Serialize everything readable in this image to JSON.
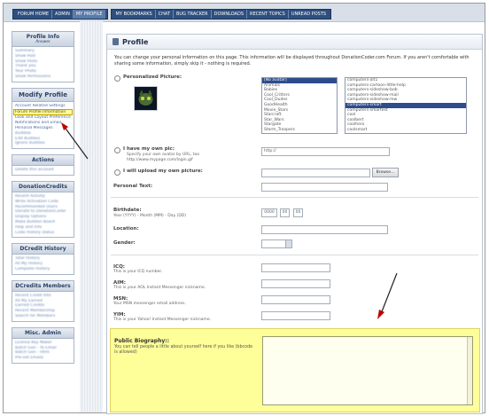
{
  "nav": {
    "group1": [
      "FORUM HOME",
      "ADMIN",
      "MY PROFILE"
    ],
    "active": "MY PROFILE",
    "group2": [
      "MY BOOKMARKS",
      "CHAT",
      "BUG TRACKER",
      "DOWNLOADS",
      "RECENT TOPICS",
      "UNREAD POSTS"
    ]
  },
  "sidebar": {
    "profile_info": {
      "title": "Profile Info",
      "subtitle": "Answer",
      "links": [
        "Summary",
        "Show Post",
        "Show Posts",
        "Thank you",
        "Your Photo",
        "Show Permissions"
      ]
    },
    "modify_profile": {
      "title": "Modify Profile",
      "links": [
        "Account Related Settings",
        "Forum Profile Information",
        "Look and Layout Preferences",
        "Notifications and Email",
        "Personal Messages",
        "Buddies",
        "Edit Buddies",
        "Ignore Buddies"
      ]
    },
    "actions": {
      "title": "Actions",
      "links": [
        "Delete this account"
      ]
    },
    "donation": {
      "title": "DonationCredits",
      "links": [
        "Recent Activity",
        "Write Activation Code",
        "Recommended Users",
        "Donate to DonationCoder",
        "Display Options",
        "Make Bulletin Board",
        "Help and Info",
        "Code History status"
      ]
    },
    "dcredit": {
      "title": "DCredit History",
      "links": [
        "Total History",
        "All My History",
        "Complete History"
      ]
    },
    "members": {
      "title": "DCredits Members",
      "links": [
        "Recent Credit Info",
        "All My Earned",
        "Earned Credits",
        "Recent Membership",
        "Search for Members"
      ]
    },
    "misc": {
      "title": "Misc. Admin",
      "links": [
        "License Key Maker",
        "Batch Gen - Yo Email",
        "Batch Gen - Html",
        "Pre-set Emails"
      ]
    }
  },
  "page": {
    "title": "Profile",
    "intro": "You can change your personal information on this page. This information will be displayed throughout DonationCoder.com Forum. If you aren't comfortable with sharing some information, simply skip it - nothing is required.",
    "personal_picture": "Personalized Picture:",
    "gallery_left": [
      "[No avatar]",
      "Animals",
      "Babies",
      "Cool_Critters",
      "Cool_Dudes",
      "GoodHealth",
      "Movie_Stars",
      "Starcraft",
      "Star_Wars",
      "Stargate",
      "Storm_Troopers"
    ],
    "gallery_right": [
      "computers-alt1",
      "computers-cartoon-little-help",
      "computers-sideshow-bob",
      "computers-sideshow-mail",
      "computers-sideshow-mw",
      "computers-smart",
      "computers-smartest",
      "cool",
      "coolbert",
      "coolhero",
      "coolsmart"
    ],
    "gallery_right_selected": "computers-smartest",
    "own_pic_label": "I have my own pic:",
    "own_pic_hint1": "Specify your own avatar by URL, too",
    "own_pic_hint2": "http://www.mypage.com/login.gif",
    "own_pic_value": "http://",
    "upload_label": "I will upload my own picture:",
    "browse": "Browse...",
    "personal_text": "Personal Text:",
    "birthdate": "Birthdate:",
    "birthdate_hint": "Year (YYYY) - Month (MM) - Day (DD)",
    "birth_year": "0000",
    "birth_month": "00",
    "birth_day": "00",
    "location": "Location:",
    "gender": "Gender:",
    "icq": "ICQ:",
    "icq_hint": "This is your ICQ number.",
    "aim": "AIM:",
    "aim_hint": "This is your AOL Instant Messenger nickname.",
    "msn": "MSN:",
    "msn_hint": "Your MSN messenger email address.",
    "yim": "YIM:",
    "yim_hint": "This is your Yahoo! Instant Messenger nickname.",
    "bio_label": "Public Biography::",
    "bio_hint": "You can tell people a little about yourself here if you like (bbcode is allowed)"
  },
  "colors": {
    "highlight": "#ffff99",
    "nav": "#2e4f7e",
    "arrow": "#c00000"
  }
}
